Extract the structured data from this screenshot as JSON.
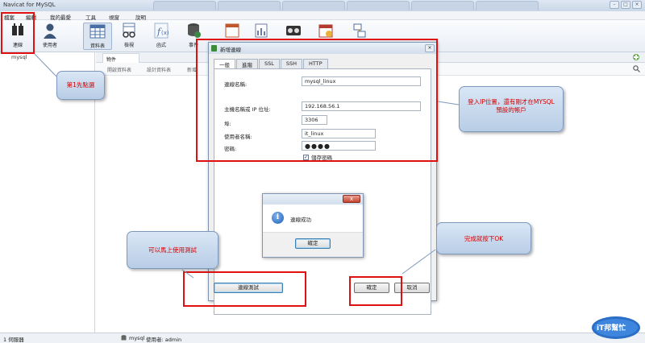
{
  "window": {
    "title": "Navicat for MySQL",
    "controls": [
      "–",
      "□",
      "×"
    ]
  },
  "menu": [
    "檔案",
    "編輯",
    "我的最愛",
    "工具",
    "視窗",
    "說明"
  ],
  "toolbar": [
    {
      "label": "連線",
      "icon": "plug-icon",
      "color": "#2b2b2b"
    },
    {
      "label": "使用者",
      "icon": "user-icon",
      "color": "#334a6b"
    },
    {
      "label": "資料表",
      "icon": "table-icon",
      "color": "#4a6fa5"
    },
    {
      "label": "檢視",
      "icon": "view-icon",
      "color": "#5a7aa8"
    },
    {
      "label": "函式",
      "icon": "function-icon",
      "color": "#6f8fbf"
    },
    {
      "label": "事件",
      "icon": "event-icon",
      "color": "#3a8a45"
    }
  ],
  "nav": {
    "connection": "mysql"
  },
  "object_tab": "物件",
  "object_toolbar": [
    "開啟資料表",
    "設計資料表",
    "新增"
  ],
  "dialog": {
    "title": "新增連線",
    "tabs": [
      "一般",
      "進階",
      "SSL",
      "SSH",
      "HTTP"
    ],
    "fields": {
      "conn_name_label": "連線名稱:",
      "conn_name": "mysql_linux",
      "host_label": "主機名稱或 IP 位址:",
      "host": "192.168.56.1",
      "port_label": "埠:",
      "port": "3306",
      "user_label": "使用者名稱:",
      "user": "it_linux",
      "pass_label": "密碼:",
      "pass": "●●●●",
      "save_pass": "儲存密碼"
    },
    "test_button": "連線測試",
    "ok_button": "確定",
    "cancel_button": "取消"
  },
  "message": {
    "text": "連線成功",
    "ok": "確定",
    "close": "x"
  },
  "status": {
    "servers": "1 伺服器",
    "conn": "mysql",
    "user": "使用者: admin"
  },
  "annotations": {
    "step1": "第1先點選",
    "login": "登入IP位置，還有剛才在MYSQL預設的帳戶",
    "test": "可以馬上使用測試",
    "done": "完成就按下OK"
  },
  "logo_text": "iT邦幫忙",
  "colors": {
    "highlight": "#e01010",
    "callout_text": "#d40000",
    "callout_bg": "#c9d9ee"
  }
}
